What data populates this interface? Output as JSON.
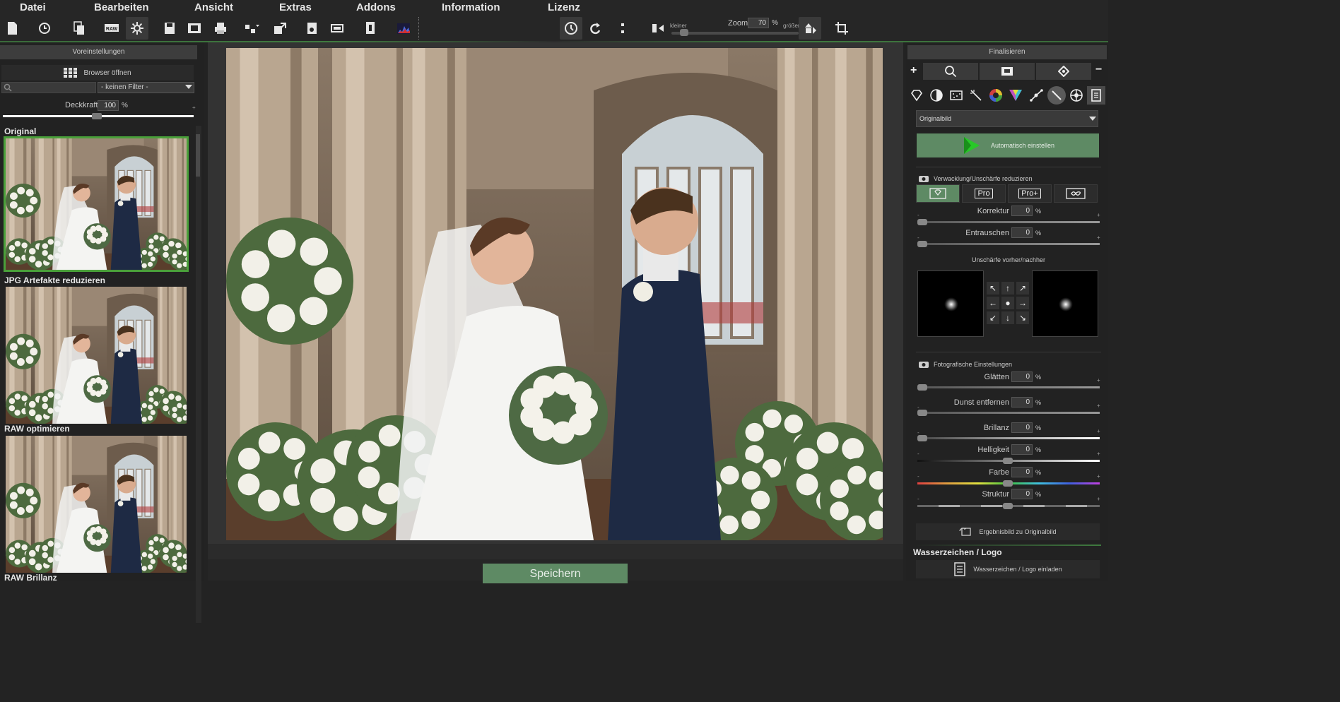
{
  "menu": [
    "Datei",
    "Bearbeiten",
    "Ansicht",
    "Extras",
    "Addons",
    "Information",
    "Lizenz"
  ],
  "toolbar": {
    "zoom_label": "Zoom",
    "zoom_value": "70",
    "zoom_unit": "%",
    "zoom_smaller": "kleiner",
    "zoom_larger": "größer",
    "icons": [
      "new-document-icon",
      "history-icon",
      "copy-document-icon",
      "raw-icon",
      "settings-gear-icon",
      "save-icon",
      "film-strip-icon",
      "print-icon",
      "layout-dropdown-icon",
      "export-icon",
      "batch-icon",
      "compare-icon",
      "info-document-icon",
      "histogram-icon",
      "time-compare-icon",
      "redo-icon",
      "split-icon",
      "flip-icon",
      "zoom-fit-icon",
      "crop-icon"
    ]
  },
  "left_panel": {
    "title": "Voreinstellungen",
    "browser_button": "Browser öffnen",
    "filter_select": "- keinen Filter -",
    "opacity_label": "Deckkraft",
    "opacity_value": "100",
    "opacity_unit": "%",
    "opacity_minmax": [
      "-",
      "+"
    ],
    "presets": [
      "Original",
      "JPG Artefakte reduzieren",
      "RAW optimieren",
      "RAW Brillanz"
    ]
  },
  "center": {
    "save_button": "Speichern"
  },
  "right_panel": {
    "title": "Finalisieren",
    "tab_add": "+",
    "tab_remove": "−",
    "preset_select": "Originalbild",
    "auto_button": "Automatisch einstellen",
    "deblur_section": "Verwacklung/Unschärfe reduzieren",
    "modes": [
      "",
      "Pro",
      "Pro+",
      ""
    ],
    "deblur_sliders": [
      {
        "label": "Korrektur",
        "value": "0",
        "unit": "%"
      },
      {
        "label": "Entrauschen",
        "value": "0",
        "unit": "%"
      }
    ],
    "blur_preview_title": "Unschärfe vorher/nachher",
    "arrows": [
      "↖",
      "↑",
      "↗",
      "←",
      "●",
      "→",
      "↙",
      "↓",
      "↘"
    ],
    "photo_section": "Fotografische Einstellungen",
    "photo_sliders": [
      {
        "label": "Glätten",
        "value": "0",
        "unit": "%"
      },
      {
        "label": "Dunst entfernen",
        "value": "0",
        "unit": "%"
      },
      {
        "label": "Brillanz",
        "value": "0",
        "unit": "%"
      },
      {
        "label": "Helligkeit",
        "value": "0",
        "unit": "%"
      },
      {
        "label": "Farbe",
        "value": "0",
        "unit": "%"
      },
      {
        "label": "Struktur",
        "value": "0",
        "unit": "%"
      }
    ],
    "slider_minmax": [
      "-",
      "+"
    ],
    "result_button": "Ergebnisbild zu Originalbild",
    "watermark_title": "Wasserzeichen / Logo",
    "watermark_button": "Wasserzeichen / Logo einladen"
  },
  "colors": {
    "accent_green": "#5e8a64",
    "selected_outline": "#4aa03a",
    "background": "#232323"
  }
}
